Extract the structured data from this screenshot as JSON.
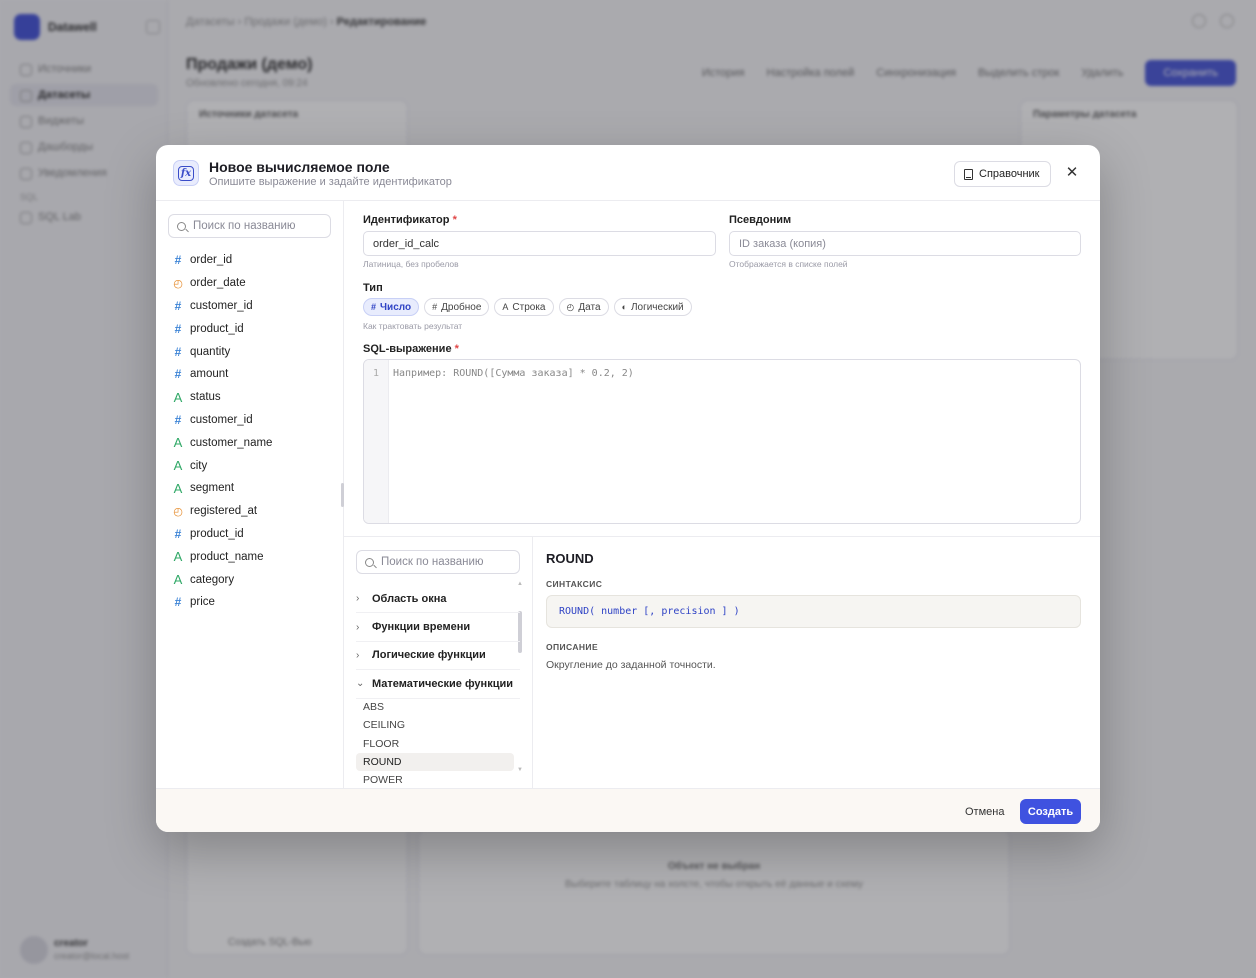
{
  "background": {
    "workspace": "Datawell",
    "nav": [
      "Источники",
      "Датасеты",
      "Виджеты",
      "Дашборды",
      "Уведомления"
    ],
    "nav_section": "SQL",
    "nav_extra": "SQL Lab",
    "user_name": "creator",
    "user_mail": "creator@local.host",
    "breadcrumb_a": "Датасеты",
    "breadcrumb_b": "Продажи (демо)",
    "breadcrumb_c": "Редактирование",
    "page_title": "Продажи (демо)",
    "page_sub": "Обновлено сегодня, 09:24",
    "toolbar": [
      "История",
      "Настройка полей",
      "Синхронизация",
      "Выделить строк",
      "Удалить"
    ],
    "save_label": "Сохранить",
    "panel_left_title": "Источники датасета",
    "panel_right_title": "Параметры датасета",
    "center_title": "Объект не выбран",
    "center_text": "Выберите таблицу на холсте, чтобы открыть её данные и схему",
    "sql_btn": "Создать SQL-Вью"
  },
  "modal": {
    "title": "Новое вычисляемое поле",
    "subtitle": "Опишите выражение и задайте идентификатор",
    "reference_button": "Справочник",
    "close": "✕",
    "field_search_placeholder": "Поиск по названию",
    "fields": [
      {
        "name": "order_id",
        "type": "num"
      },
      {
        "name": "order_date",
        "type": "date"
      },
      {
        "name": "customer_id",
        "type": "num"
      },
      {
        "name": "product_id",
        "type": "num"
      },
      {
        "name": "quantity",
        "type": "num"
      },
      {
        "name": "amount",
        "type": "num"
      },
      {
        "name": "status",
        "type": "str"
      },
      {
        "name": "customer_id",
        "type": "num"
      },
      {
        "name": "customer_name",
        "type": "str"
      },
      {
        "name": "city",
        "type": "str"
      },
      {
        "name": "segment",
        "type": "str"
      },
      {
        "name": "registered_at",
        "type": "date"
      },
      {
        "name": "product_id",
        "type": "num"
      },
      {
        "name": "product_name",
        "type": "str"
      },
      {
        "name": "category",
        "type": "str"
      },
      {
        "name": "price",
        "type": "num"
      }
    ],
    "identifier_label": "Идентификатор",
    "identifier_required": "*",
    "identifier_value": "order_id_calc",
    "identifier_hint": "Латиница, без пробелов",
    "alias_label": "Псевдоним",
    "alias_placeholder": "ID заказа (копия)",
    "alias_hint": "Отображается в списке полей",
    "type_label": "Тип",
    "types": [
      {
        "icon": "#",
        "label": "Число",
        "active": true
      },
      {
        "icon": "#",
        "label": "Дробное",
        "active": false
      },
      {
        "icon": "A",
        "label": "Строка",
        "active": false
      },
      {
        "icon": "◴",
        "label": "Дата",
        "active": false
      },
      {
        "icon": "◐",
        "label": "Логический",
        "active": false
      }
    ],
    "type_hint": "Как трактовать результат",
    "sql_label": "SQL-выражение",
    "sql_required": "*",
    "sql_line_number": "1",
    "sql_placeholder": "Например: ROUND([Сумма заказа] * 0.2, 2)",
    "function_search_placeholder": "Поиск по названию",
    "categories": [
      {
        "label": "Область окна",
        "expanded": false
      },
      {
        "label": "Функции времени",
        "expanded": false
      },
      {
        "label": "Логические функции",
        "expanded": false
      },
      {
        "label": "Математические функции",
        "expanded": true
      }
    ],
    "functions": [
      "ABS",
      "CEILING",
      "FLOOR",
      "ROUND",
      "POWER"
    ],
    "selected_function": "ROUND",
    "detail": {
      "name": "ROUND",
      "syntax_label": "СИНТАКСИС",
      "syntax": "ROUND( number [, precision ] )",
      "description_label": "ОПИСАНИЕ",
      "description": "Округление до заданной точности."
    },
    "cancel_label": "Отмена",
    "create_label": "Создать"
  }
}
